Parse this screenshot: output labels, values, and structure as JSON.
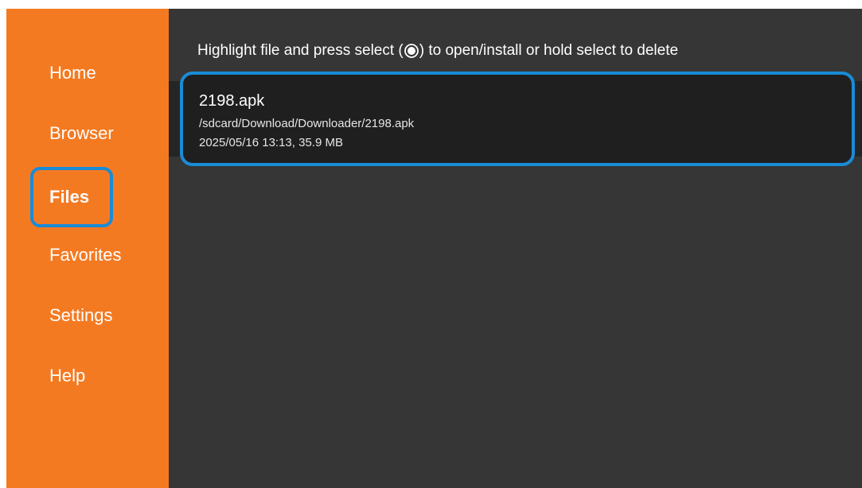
{
  "sidebar": {
    "items": [
      {
        "label": "Home"
      },
      {
        "label": "Browser"
      },
      {
        "label": "Files",
        "selected": true
      },
      {
        "label": "Favorites"
      },
      {
        "label": "Settings"
      },
      {
        "label": "Help"
      }
    ]
  },
  "main": {
    "instruction_before": "Highlight file and press select (",
    "instruction_icon": "select-button-icon",
    "instruction_after": ") to open/install or hold select to delete",
    "files": [
      {
        "name": "2198.apk",
        "path": "/sdcard/Download/Downloader/2198.apk",
        "meta": "2025/05/16 13:13, 35.9 MB"
      }
    ]
  },
  "colors": {
    "sidebar_bg": "#f47a22",
    "main_bg": "#363636",
    "focus_border": "#1a8bd6",
    "row_bg": "#252525"
  }
}
